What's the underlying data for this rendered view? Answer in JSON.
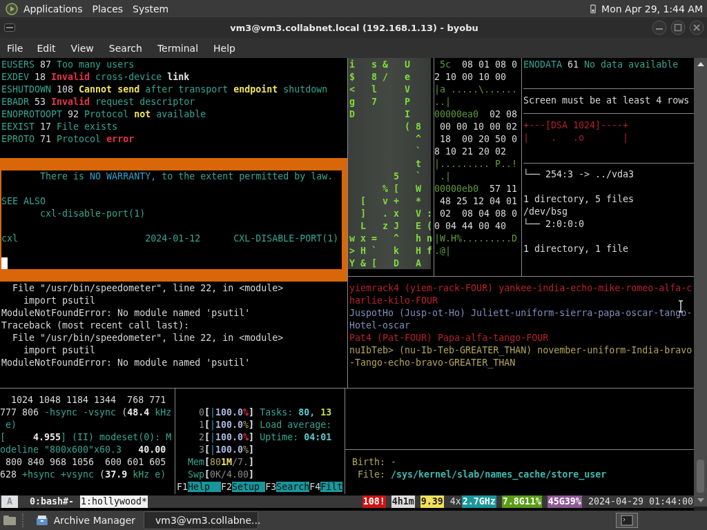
{
  "top_panel": {
    "menus": [
      "Applications",
      "Places",
      "System"
    ],
    "clock": "Mon Apr 29, 1:44 AM"
  },
  "window": {
    "title": "vm3@vm3.collabnet.local (192.168.1.13) - byobu"
  },
  "menu_bar": [
    "File",
    "Edit",
    "View",
    "Search",
    "Terminal",
    "Help"
  ],
  "terminal": {
    "errno": {
      "blocks": [
        [
          [
            {
              "text": "EUSERS",
              "kind": "teal"
            },
            {
              "text": " 87 ",
              "kind": "white"
            },
            {
              "text": "Too many users",
              "kind": "teal"
            }
          ],
          [
            {
              "text": "EXDEV",
              "kind": "teal"
            },
            {
              "text": " 18 ",
              "kind": "white"
            },
            {
              "text": "Invalid",
              "kind": "red"
            },
            {
              "text": " cross-device ",
              "kind": "teal"
            },
            {
              "text": "link",
              "kind": "bold"
            }
          ],
          [
            {
              "text": "ESHUTDOWN",
              "kind": "teal"
            },
            {
              "text": " 108 ",
              "kind": "white"
            },
            {
              "text": "Cannot send",
              "kind": "yellow"
            },
            {
              "text": " after transport ",
              "kind": "teal"
            },
            {
              "text": "endpoint",
              "kind": "yellow"
            },
            {
              "text": " shutdown",
              "kind": "teal"
            }
          ],
          [
            {
              "text": "EBADR",
              "kind": "teal"
            },
            {
              "text": " 53 ",
              "kind": "white"
            },
            {
              "text": "Invalid",
              "kind": "red"
            },
            {
              "text": " request descriptor",
              "kind": "teal"
            }
          ],
          [
            {
              "text": "ENOPROTOOPT",
              "kind": "teal"
            },
            {
              "text": " 92 ",
              "kind": "white"
            },
            {
              "text": "Protocol ",
              "kind": "teal"
            },
            {
              "text": "not",
              "kind": "yellow"
            },
            {
              "text": " available",
              "kind": "teal"
            }
          ],
          [
            {
              "text": "EEXIST",
              "kind": "teal"
            },
            {
              "text": " 17 ",
              "kind": "white"
            },
            {
              "text": "File exists",
              "kind": "teal"
            }
          ],
          [
            {
              "text": "EPROTO",
              "kind": "teal"
            },
            {
              "text": " 71 ",
              "kind": "white"
            },
            {
              "text": "Protocol ",
              "kind": "teal"
            },
            {
              "text": "error",
              "kind": "red"
            }
          ]
        ]
      ]
    },
    "man_page": {
      "active": true,
      "cursor": true,
      "blocks": [
        [
          [
            {
              "text": "       There is ",
              "kind": "teal"
            },
            {
              "text": "NO WARRANTY,",
              "kind": "blue"
            },
            {
              "text": " to the extent permitted by law.",
              "kind": "teal"
            }
          ]
        ],
        [
          [
            {
              "text": "SEE ALSO",
              "kind": "teal"
            }
          ],
          [
            {
              "text": "       cxl-disable-port(1)",
              "kind": "teal"
            }
          ]
        ],
        [
          [
            {
              "text": "cxl                       2024-01-12      CXL-DISABLE-PORT(1)",
              "kind": "teal"
            }
          ]
        ]
      ]
    },
    "traceback": {
      "blocks": [
        [
          [
            {
              "text": "  File \"/usr/bin/speedometer\", line 22, in <module>",
              "kind": "white"
            }
          ],
          [
            {
              "text": "    import psutil",
              "kind": "white"
            }
          ],
          [
            {
              "text": "ModuleNotFoundError: No module named 'psutil'",
              "kind": "white"
            }
          ],
          [
            {
              "text": "Traceback (most recent call last):",
              "kind": "white"
            }
          ],
          [
            {
              "text": "  File \"/usr/bin/speedometer\", line 22, in <module>",
              "kind": "white"
            }
          ],
          [
            {
              "text": "    import psutil",
              "kind": "white"
            }
          ],
          [
            {
              "text": "ModuleNotFoundError: No module named 'psutil'",
              "kind": "white"
            }
          ]
        ]
      ]
    },
    "matrix": {
      "blocks": [
        [
          [
            {
              "text": "i   s &   U",
              "kind": "green"
            }
          ],
          [
            {
              "text": "$   8 /   e",
              "kind": "green"
            }
          ],
          [
            {
              "text": "<   l     V",
              "kind": "green"
            }
          ],
          [
            {
              "text": "g   7     P",
              "kind": "green"
            }
          ],
          [
            {
              "text": "D         I",
              "kind": "green"
            }
          ],
          [
            {
              "text": "          ( 8",
              "kind": "green"
            }
          ],
          [
            {
              "text": "            ^",
              "kind": "green"
            }
          ],
          [
            {
              "text": "            `",
              "kind": "green"
            }
          ],
          [
            {
              "text": "            t",
              "kind": "green"
            }
          ],
          [
            {
              "text": "        5   `",
              "kind": "green"
            }
          ],
          [
            {
              "text": "      % [   W",
              "kind": "green"
            }
          ],
          [
            {
              "text": "  [   v +   *",
              "kind": "green"
            }
          ],
          [
            {
              "text": "  ]   . x   V :",
              "kind": "green"
            }
          ],
          [
            {
              "text": "  L   z J   E (",
              "kind": "green"
            }
          ],
          [
            {
              "text": "w x =   ^   h n",
              "kind": "green"
            }
          ],
          [
            {
              "text": "> H `   k   H f",
              "kind": "green"
            }
          ],
          [
            {
              "text": "Y & [   D   A",
              "kind": "green"
            }
          ]
        ]
      ]
    },
    "hexdump": {
      "blocks": [
        [
          [
            {
              "text": " 5c",
              "kind": "hexdim"
            },
            {
              "text": "  08 01 08 0",
              "kind": "white"
            }
          ],
          [
            {
              "text": "2 10 00 10 00",
              "kind": "white"
            }
          ],
          [
            {
              "text": "|a .....\\......",
              "kind": "hexdim"
            }
          ],
          [
            {
              "text": "..|",
              "kind": "hexdim"
            }
          ],
          [
            {
              "text": "00000ea0",
              "kind": "hexdim"
            },
            {
              "text": "  02 08",
              "kind": "white"
            }
          ],
          [
            {
              "text": " 00 00 10 00 02",
              "kind": "white"
            }
          ],
          [
            {
              "text": " 18  00 20 50 0",
              "kind": "white"
            }
          ],
          [
            {
              "text": "8 10 21 20 02",
              "kind": "white"
            }
          ],
          [
            {
              "text": "|......... P..!",
              "kind": "hexdim"
            }
          ],
          [
            {
              "text": " .|",
              "kind": "hexdim"
            }
          ],
          [
            {
              "text": "00000eb0",
              "kind": "hexdim"
            },
            {
              "text": "  57 11",
              "kind": "white"
            }
          ],
          [
            {
              "text": " 48 25 12 04 01",
              "kind": "white"
            }
          ],
          [
            {
              "text": " 02  08 04 08 0",
              "kind": "white"
            }
          ],
          [
            {
              "text": "0 04 44 00 40",
              "kind": "white"
            }
          ],
          [
            {
              "text": "|W.H%.........D",
              "kind": "hexdim"
            }
          ],
          [
            {
              "text": ".@|",
              "kind": "hexdim"
            }
          ]
        ]
      ]
    },
    "enodata": {
      "blocks": [
        [
          [
            {
              "text": "ENODATA",
              "kind": "teal"
            },
            {
              "text": " 61 ",
              "kind": "white"
            },
            {
              "text": "No data available",
              "kind": "teal"
            }
          ]
        ]
      ]
    },
    "screen_warning": {
      "blocks": [
        [
          [
            {
              "text": "Screen must be at least 4 rows",
              "kind": "white"
            }
          ]
        ]
      ]
    },
    "dsa_art": {
      "blocks": [
        [
          [
            {
              "text": "+---[DSA 1024]----+",
              "kind": "dimred"
            }
          ],
          [
            {
              "text": "|    .   .o       |",
              "kind": "dimred"
            }
          ]
        ]
      ]
    },
    "tree": {
      "blocks": [
        [
          [
            {
              "text": "└── 254:3 -> ../vda3",
              "kind": "white"
            }
          ]
        ],
        [
          [
            {
              "text": "1 directory, 5 files",
              "kind": "white"
            }
          ],
          [
            {
              "text": "/dev/bsg",
              "kind": "white"
            }
          ],
          [
            {
              "text": "└── 2:0:0:0",
              "kind": "white"
            }
          ]
        ],
        [
          [
            {
              "text": "1 directory, 1 file",
              "kind": "white"
            }
          ]
        ]
      ]
    },
    "nato": {
      "blocks": [
        [
          [
            {
              "text": "yiemrack4 (yiem-rack-FOUR) yankee-india-echo-mike-romeo-alfa-c",
              "kind": "dimred"
            }
          ],
          [
            {
              "text": "harlie-kilo-FOUR",
              "kind": "dimred"
            }
          ],
          [
            {
              "text": "JuspotHo (Jusp-ot-Ho) Juliett-uniform-sierra-papa-oscar-tango-",
              "kind": "slate"
            }
          ],
          [
            {
              "text": "Hotel-oscar",
              "kind": "slate"
            }
          ],
          [
            {
              "text": "Pat4 (Pat-FOUR) Papa-alfa-tango-FOUR",
              "kind": "dimred"
            }
          ],
          [
            {
              "text": "nuIbTeb> (nu-Ib-Teb-GREATER_THAN) november-uniform-India-bravo",
              "kind": "olive"
            }
          ],
          [
            {
              "text": "-Tango-echo-bravo-GREATER_THAN",
              "kind": "olive"
            }
          ]
        ]
      ]
    },
    "xrandr": {
      "blocks": [
        [
          [
            {
              "text": "  1024 1048 1184 1344  768 771",
              "kind": "white"
            }
          ],
          [
            {
              "text": "777 806 ",
              "kind": "white"
            },
            {
              "text": "-hsync -vsync",
              "kind": "teal"
            },
            {
              "text": " (",
              "kind": "white"
            },
            {
              "text": "48.4",
              "kind": "bold"
            },
            {
              "text": " kHz",
              "kind": "teal"
            }
          ],
          [
            {
              "text": " e)",
              "kind": "teal"
            }
          ],
          [
            {
              "text": "[",
              "kind": "teal"
            },
            {
              "text": "     4.955",
              "kind": "bold"
            },
            {
              "text": "] (II) modeset(0): M",
              "kind": "teal"
            }
          ],
          [
            {
              "text": "odeline \"800x600\"x60.3",
              "kind": "teal"
            },
            {
              "text": "   40.00",
              "kind": "bold"
            }
          ],
          [
            {
              "text": " 800 840 968 1056  600 601 605",
              "kind": "white"
            }
          ],
          [
            {
              "text": "628 ",
              "kind": "white"
            },
            {
              "text": "+hsync +vsync",
              "kind": "teal"
            },
            {
              "text": " (",
              "kind": "white"
            },
            {
              "text": "37.9",
              "kind": "bold"
            },
            {
              "text": " kHz e)",
              "kind": "teal"
            }
          ]
        ]
      ]
    },
    "htop": {
      "blocks": [
        [
          [
            {
              "text": "    0",
              "kind": "dim"
            },
            {
              "text": "[",
              "kind": "bold"
            },
            {
              "text": "|",
              "kind": "blue"
            },
            {
              "text": "100.0",
              "kind": "boldblue"
            },
            {
              "text": "%",
              "kind": "red"
            },
            {
              "text": "]",
              "kind": "bold"
            },
            {
              "text": " Tasks: ",
              "kind": "teal"
            },
            {
              "text": "80, ",
              "kind": "boldcyan"
            },
            {
              "text": "13",
              "kind": "boldlime"
            }
          ],
          [
            {
              "text": "    1",
              "kind": "dim"
            },
            {
              "text": "[",
              "kind": "bold"
            },
            {
              "text": "|",
              "kind": "blue"
            },
            {
              "text": "100.0",
              "kind": "boldblue"
            },
            {
              "text": "%",
              "kind": "olive"
            },
            {
              "text": "]",
              "kind": "bold"
            },
            {
              "text": " Load average:",
              "kind": "teal"
            }
          ],
          [
            {
              "text": "    2",
              "kind": "dim"
            },
            {
              "text": "[",
              "kind": "bold"
            },
            {
              "text": "|",
              "kind": "blue"
            },
            {
              "text": "100.0",
              "kind": "boldblue"
            },
            {
              "text": "%",
              "kind": "red"
            },
            {
              "text": "]",
              "kind": "bold"
            },
            {
              "text": " Uptime: ",
              "kind": "teal"
            },
            {
              "text": "04:01",
              "kind": "boldcyan"
            }
          ],
          [
            {
              "text": "    3",
              "kind": "dim"
            },
            {
              "text": "[",
              "kind": "bold"
            },
            {
              "text": "|",
              "kind": "blue"
            },
            {
              "text": "100.0",
              "kind": "boldblue"
            },
            {
              "text": "%",
              "kind": "olive"
            },
            {
              "text": "]",
              "kind": "bold"
            }
          ],
          [
            {
              "text": "  Mem",
              "kind": "teal"
            },
            {
              "text": "[",
              "kind": "bold"
            },
            {
              "text": "80",
              "kind": "olive"
            },
            {
              "text": "1M",
              "kind": "yellow"
            },
            {
              "text": "/7.",
              "kind": "dim"
            },
            {
              "text": "]",
              "kind": "bold"
            }
          ],
          [
            {
              "text": "  Swp",
              "kind": "teal"
            },
            {
              "text": "[",
              "kind": "bold"
            },
            {
              "text": "0K/4.00",
              "kind": "dim"
            },
            {
              "text": "]",
              "kind": "bold"
            }
          ],
          [
            {
              "text": "F1",
              "kind": "white"
            },
            {
              "text": "Help  ",
              "kind": "key"
            },
            {
              "text": "F2",
              "kind": "white"
            },
            {
              "text": "Setup ",
              "kind": "key"
            },
            {
              "text": "F3",
              "kind": "white"
            },
            {
              "text": "Search",
              "kind": "key"
            },
            {
              "text": "F4",
              "kind": "white"
            },
            {
              "text": "Filt",
              "kind": "key"
            }
          ]
        ]
      ]
    },
    "stat": {
      "blocks": [
        [
          [
            {
              "text": "Birth: -",
              "kind": "olive"
            }
          ],
          [
            {
              "text": " File: ",
              "kind": "olive"
            },
            {
              "text": "/sys/kernel/slab/names_cache/store_user",
              "kind": "boldteal"
            }
          ]
        ]
      ]
    }
  },
  "status_bar": {
    "session": "A",
    "windows": [
      {
        "label": "0:bash#-",
        "selected": false
      },
      {
        "label": "1:hollywood*",
        "selected": true
      }
    ],
    "right": [
      {
        "text": "108!",
        "color": "#cc1515"
      },
      {
        "text": "4h1m",
        "color": "#dcdcdc"
      },
      {
        "text": "9.39",
        "color": "#f2e05a"
      },
      {
        "text": "4x"
      },
      {
        "text": "2.7GHz",
        "color": "#19979c"
      },
      {
        "text": "7.8G11%",
        "color": "#5a9c18"
      },
      {
        "text": "45G39%",
        "color": "#8e5a95"
      },
      {
        "text": "2024-04-29 01:44:00"
      }
    ]
  },
  "taskbar": {
    "tasks": [
      {
        "label": "Archive Manager",
        "selected": false
      },
      {
        "label": "vm3@vm3.collabne...",
        "selected": true
      }
    ]
  }
}
